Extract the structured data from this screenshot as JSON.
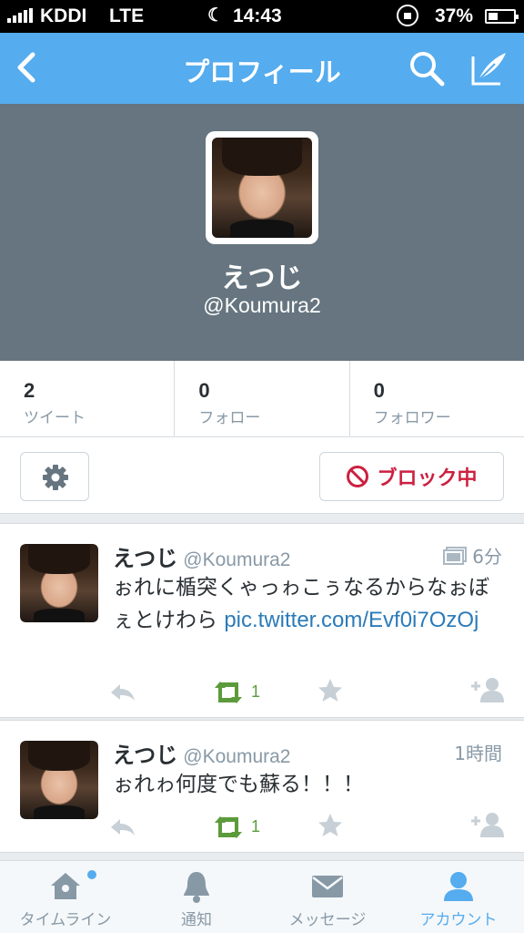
{
  "status_bar": {
    "carrier": "KDDI",
    "network": "LTE",
    "time": "14:43",
    "battery": "37%"
  },
  "nav": {
    "title": "プロフィール"
  },
  "profile": {
    "display_name": "えつじ",
    "screen_name": "@Koumura2"
  },
  "stats": [
    {
      "count": "2",
      "label": "ツイート"
    },
    {
      "count": "0",
      "label": "フォロー"
    },
    {
      "count": "0",
      "label": "フォロワー"
    }
  ],
  "actions": {
    "block_label": "ブロック中"
  },
  "tweets": [
    {
      "name": "えつじ",
      "handle": "@Koumura2",
      "time": "6分",
      "text": "ぉれに楯突くゃっゎこぅなるからなぉぼぇとけわら ",
      "link": "pic.twitter.com/Evf0i7OzOj",
      "retweets": "1"
    },
    {
      "name": "えつじ",
      "handle": "@Koumura2",
      "time": "1時間",
      "text": "ぉれゎ何度でも蘇る！！！",
      "retweets": "1"
    }
  ],
  "tabs": [
    {
      "label": "タイムライン"
    },
    {
      "label": "通知"
    },
    {
      "label": "メッセージ"
    },
    {
      "label": "アカウント"
    }
  ],
  "colors": {
    "accent": "#55acee",
    "header_bg": "#66757f",
    "block_red": "#cc2040",
    "retweet_green": "#5c9b3b"
  }
}
